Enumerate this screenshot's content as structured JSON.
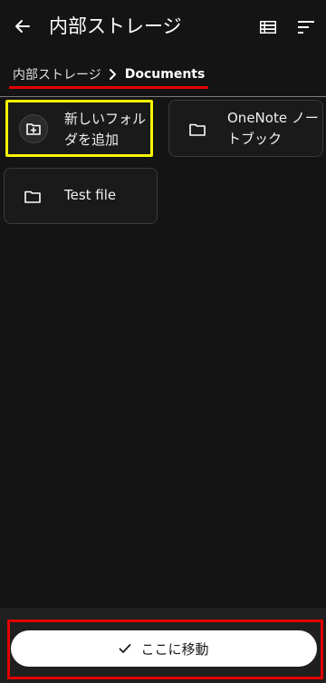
{
  "header": {
    "title": "内部ストレージ",
    "back_icon": "arrow-left-icon",
    "list_view_icon": "list-view-icon",
    "sort_icon": "sort-icon"
  },
  "breadcrumb": {
    "root": "内部ストレージ",
    "separator_icon": "chevron-right-icon",
    "current": "Documents"
  },
  "items": [
    {
      "label": "新しいフォルダを追加",
      "icon": "new-folder-icon"
    },
    {
      "label": "OneNote ノートブック",
      "icon": "folder-icon"
    },
    {
      "label": "Test file",
      "icon": "folder-icon"
    }
  ],
  "action": {
    "label": "ここに移動",
    "icon": "check-icon"
  },
  "colors": {
    "background": "#141414",
    "highlight_yellow": "#f5f500",
    "highlight_red": "#e00000",
    "button_bg": "#ffffff"
  }
}
